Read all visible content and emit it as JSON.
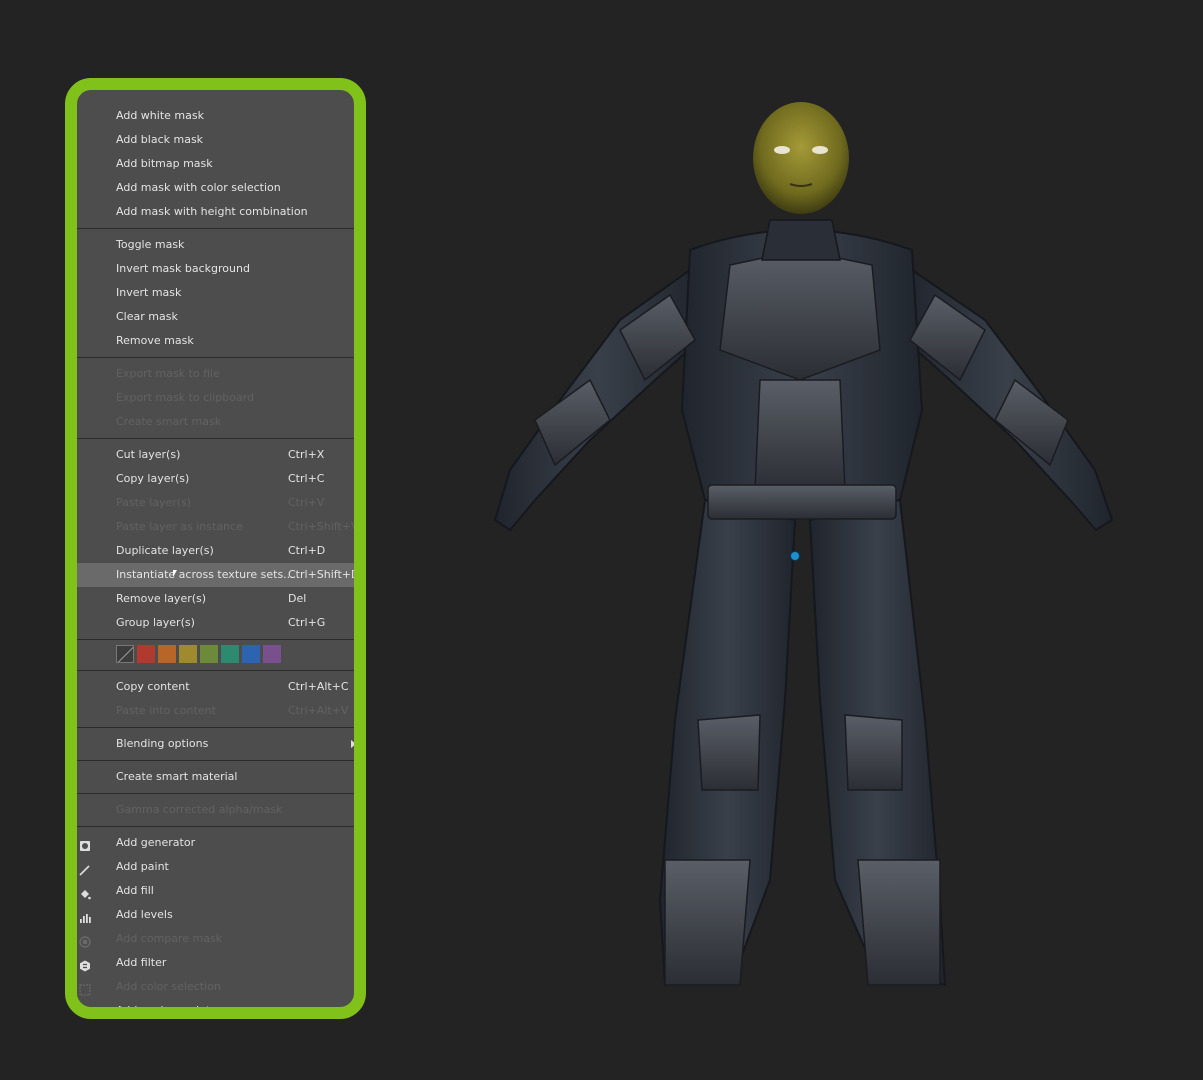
{
  "context_menu": {
    "sections": [
      {
        "items": [
          {
            "label": "Add white mask"
          },
          {
            "label": "Add black mask"
          },
          {
            "label": "Add bitmap mask"
          },
          {
            "label": "Add mask with color selection"
          },
          {
            "label": "Add mask with height combination"
          }
        ]
      },
      {
        "items": [
          {
            "label": "Toggle mask"
          },
          {
            "label": "Invert mask background"
          },
          {
            "label": "Invert mask"
          },
          {
            "label": "Clear mask"
          },
          {
            "label": "Remove mask"
          }
        ]
      },
      {
        "items": [
          {
            "label": "Export mask to file",
            "disabled": true
          },
          {
            "label": "Export mask to clipboard",
            "disabled": true
          },
          {
            "label": "Create smart mask",
            "disabled": true
          }
        ]
      },
      {
        "items": [
          {
            "label": "Cut layer(s)",
            "shortcut": "Ctrl+X"
          },
          {
            "label": "Copy layer(s)",
            "shortcut": "Ctrl+C"
          },
          {
            "label": "Paste layer(s)",
            "shortcut": "Ctrl+V",
            "disabled": true
          },
          {
            "label": "Paste layer as instance",
            "shortcut": "Ctrl+Shift+V",
            "disabled": true
          },
          {
            "label": "Duplicate layer(s)",
            "shortcut": "Ctrl+D"
          },
          {
            "label": "Instantiate across texture sets...",
            "shortcut": "Ctrl+Shift+D",
            "highlighted": true
          },
          {
            "label": "Remove layer(s)",
            "shortcut": "Del"
          },
          {
            "label": "Group layer(s)",
            "shortcut": "Ctrl+G"
          }
        ]
      },
      {
        "swatches": [
          "none",
          "#b03a2e",
          "#b8652a",
          "#a08a2e",
          "#6d8a3a",
          "#2e8a6e",
          "#2d63b0",
          "#7a4f8e"
        ]
      },
      {
        "items": [
          {
            "label": "Copy content",
            "shortcut": "Ctrl+Alt+C"
          },
          {
            "label": "Paste into content",
            "shortcut": "Ctrl+Alt+V",
            "disabled": true
          }
        ]
      },
      {
        "items": [
          {
            "label": "Blending options",
            "submenu": true
          }
        ]
      },
      {
        "items": [
          {
            "label": "Create smart material"
          }
        ]
      },
      {
        "items": [
          {
            "label": "Gamma corrected alpha/mask",
            "disabled": true
          }
        ]
      },
      {
        "items": [
          {
            "label": "Add generator",
            "icon": "generator-icon"
          },
          {
            "label": "Add paint",
            "icon": "paint-brush-icon"
          },
          {
            "label": "Add fill",
            "icon": "fill-bucket-icon"
          },
          {
            "label": "Add levels",
            "icon": "levels-icon"
          },
          {
            "label": "Add compare mask",
            "icon": "compare-mask-icon",
            "disabled": true
          },
          {
            "label": "Add filter",
            "icon": "filter-icon"
          },
          {
            "label": "Add color selection",
            "icon": "color-selection-icon",
            "disabled": true
          },
          {
            "label": "Add anchor point",
            "icon": "anchor-icon"
          }
        ]
      }
    ]
  },
  "colors": {
    "highlight_frame": "#80c21a",
    "menu_bg": "#4d4d4d",
    "viewport_bg": "#232323",
    "gizmo": "#1d8fd0"
  }
}
